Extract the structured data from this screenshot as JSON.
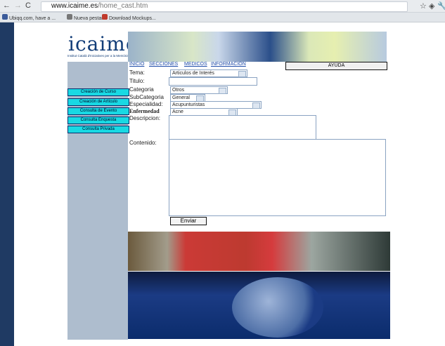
{
  "browser": {
    "url_host": "www.icaime.es",
    "url_path": "/home_cast.htm",
    "bookmarks": [
      {
        "label": "Ubiqq.com, have a ..."
      },
      {
        "label": "Nueva pestaña"
      },
      {
        "label": "Download Mockups..."
      }
    ]
  },
  "site": {
    "logo": "icaime",
    "logo_sub": "Institut Català d'Iniciatives per a la Memòria",
    "menu": [
      "INICIO",
      "SECCIONES",
      "MEDICOS",
      "INFORMACION"
    ],
    "help": "AYUDA"
  },
  "sidebar": [
    "Creación de Curso",
    "Creación de Artículo",
    "Consulta de Evento",
    "Consulta Enquesta",
    "Consulta Privada"
  ],
  "form": {
    "tema_label": "Tema:",
    "tema_value": "Articulos de Interés",
    "titulo_label": "Titulo:",
    "categoria_label": "Categoria",
    "categoria_value": "Otros",
    "subcategoria_label": "SubCategoria",
    "subcategoria_value": "General",
    "especialidad_label": "Especialidad:",
    "especialidad_value": "Acupunturistas",
    "enfermedad_label": "Enfermedad",
    "enfermedad_value": "Acne",
    "descripcion_label": "Descripcion:",
    "contenido_label": "Contenido:",
    "submit": "Enviar"
  }
}
